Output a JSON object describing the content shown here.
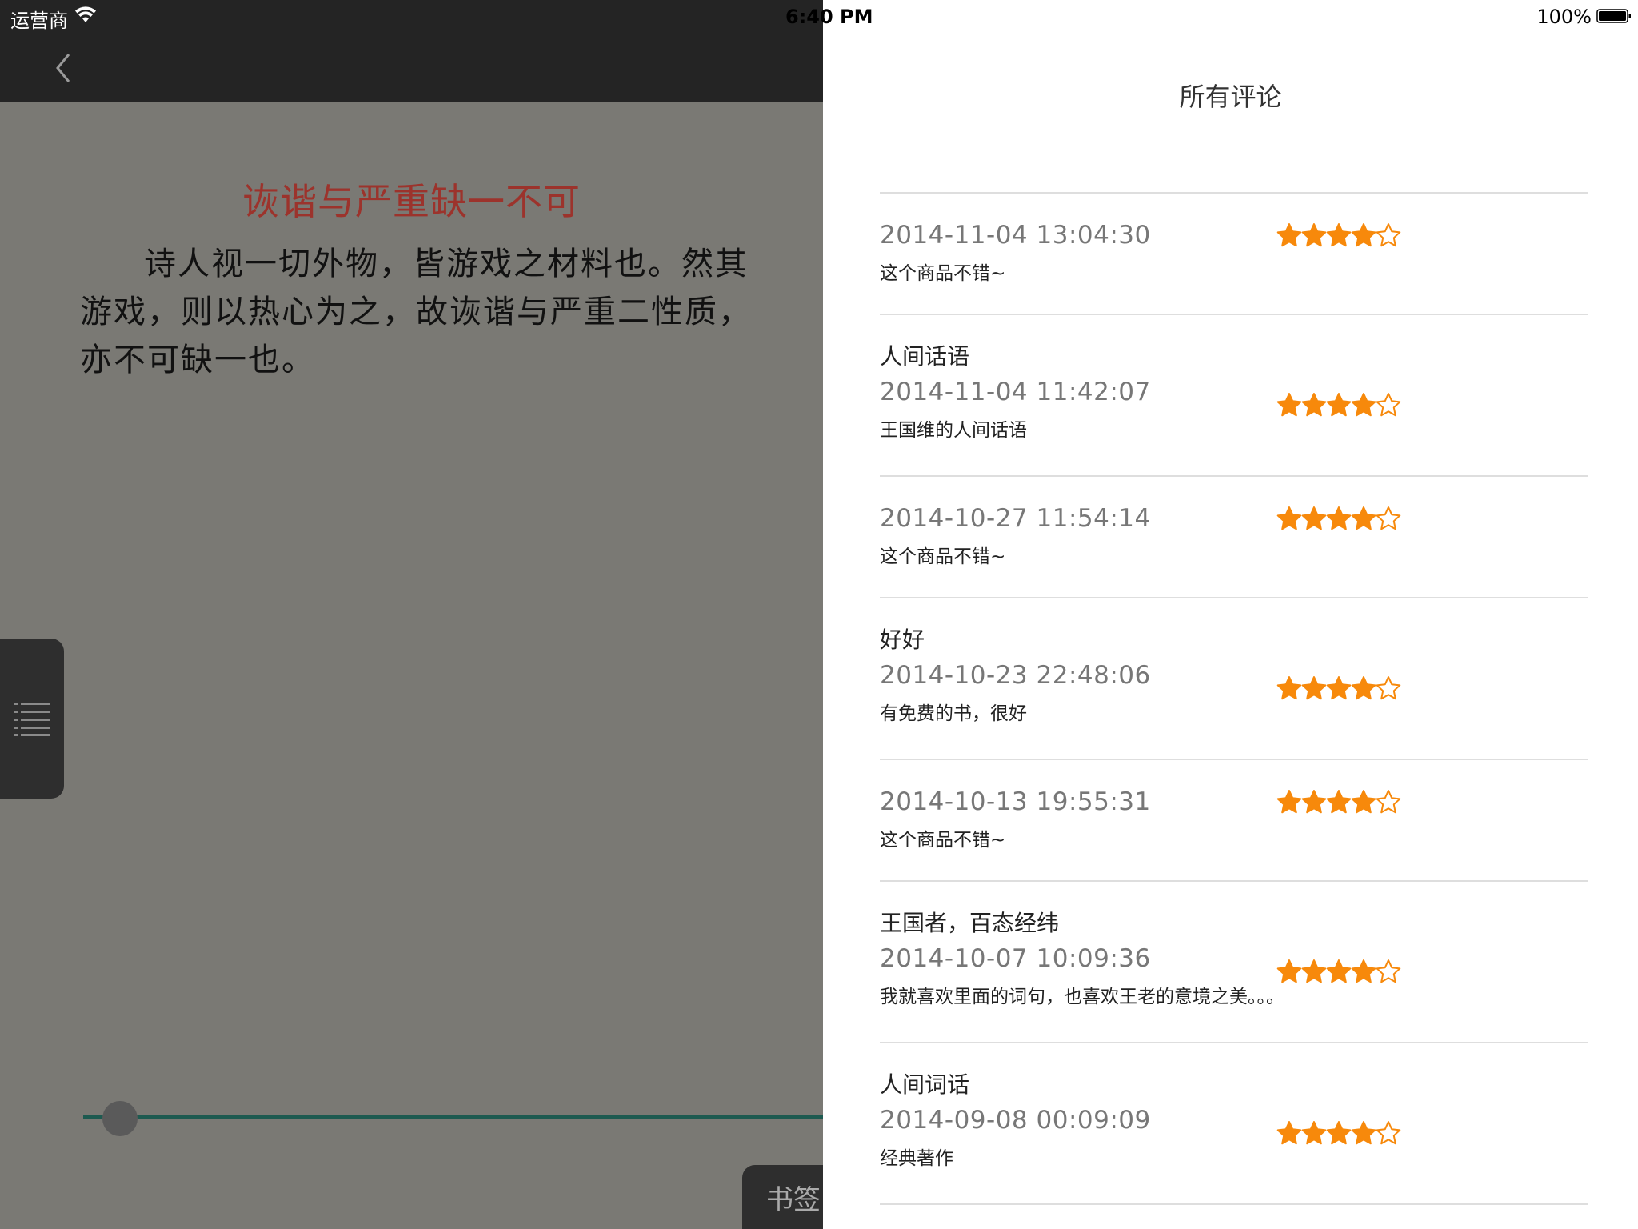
{
  "status_bar": {
    "carrier": "运营商",
    "time": "6:40 PM",
    "battery": "100%"
  },
  "reader": {
    "chapter_title": "诙谐与严重缺一不可",
    "chapter_body": "诗人视一切外物，皆游戏之材料也。然其游戏，则以热心为之，故诙谐与严重二性质，亦不可缺一也。",
    "bookmark_label": "书签",
    "progress": 0.05
  },
  "comments": {
    "title": "所有评论",
    "items": [
      {
        "title": "",
        "date": "2014-11-04 13:04:30",
        "text": "这个商品不错~",
        "rating": 4
      },
      {
        "title": "人间话语",
        "date": "2014-11-04 11:42:07",
        "text": "王国维的人间话语",
        "rating": 4
      },
      {
        "title": "",
        "date": "2014-10-27 11:54:14",
        "text": "这个商品不错~",
        "rating": 4
      },
      {
        "title": "好好",
        "date": "2014-10-23 22:48:06",
        "text": "有免费的书，很好",
        "rating": 4
      },
      {
        "title": "",
        "date": "2014-10-13 19:55:31",
        "text": "这个商品不错~",
        "rating": 4
      },
      {
        "title": "王国者，百态经纬",
        "date": "2014-10-07 10:09:36",
        "text": "我就喜欢里面的词句，也喜欢王老的意境之美。。。",
        "rating": 4
      },
      {
        "title": "人间词话",
        "date": "2014-09-08 00:09:09",
        "text": "经典著作",
        "rating": 4
      }
    ]
  },
  "colors": {
    "star": "#f7890b",
    "title_red": "#9c332c",
    "progress_track": "#1d5a50"
  },
  "icons": {
    "wifi": "wifi-icon",
    "back": "chevron-left-icon",
    "toc": "list-icon",
    "battery": "battery-icon",
    "star": "star-icon"
  }
}
